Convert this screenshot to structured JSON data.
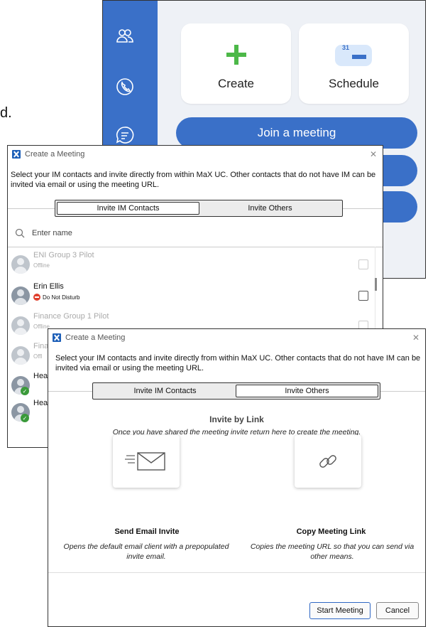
{
  "background_fragment": "d.",
  "app": {
    "rail_icons": [
      "contacts-icon",
      "phone-icon",
      "chat-icon"
    ],
    "tiles": [
      {
        "label": "Create",
        "icon": "plus-icon",
        "accent": "#4cb848"
      },
      {
        "label": "Schedule",
        "icon": "calendar-icon",
        "badge": "31"
      }
    ],
    "join_label": "Join a meeting",
    "rail_color": "#3a70c8"
  },
  "dialog1": {
    "title": "Create a Meeting",
    "description": "Select your IM contacts and invite directly from within MaX UC.  Other contacts that do not have IM can be invited via email or using the meeting URL.",
    "tabs": [
      "Invite IM Contacts",
      "Invite Others"
    ],
    "active_tab": "Invite IM Contacts",
    "search_placeholder": "Enter name",
    "contacts": [
      {
        "name": "ENI Group 3 Pilot",
        "status": "Offline",
        "dim": true
      },
      {
        "name": "Erin Ellis",
        "status": "Do Not Disturb",
        "dim": false
      },
      {
        "name": "Finance Group 1 Pilot",
        "status": "Offline",
        "dim": true
      },
      {
        "name": "Fina",
        "status": "Offl",
        "dim": true
      },
      {
        "name": "Hea",
        "status": "",
        "dim": false
      },
      {
        "name": "Hea",
        "status": "",
        "dim": false
      }
    ]
  },
  "dialog2": {
    "title": "Create a Meeting",
    "description": "Select your IM contacts and invite directly from within MaX UC.  Other contacts that do not have IM can be invited via email or using the meeting URL.",
    "tabs": [
      "Invite IM Contacts",
      "Invite Others"
    ],
    "active_tab": "Invite Others",
    "heading": "Invite by Link",
    "subheading": "Once you have shared the meeting invite return here to create the meeting.",
    "options": [
      {
        "label": "Send Email Invite",
        "icon": "envelope-icon",
        "desc": "Opens the default email client with a prepopulated invite email."
      },
      {
        "label": "Copy Meeting Link",
        "icon": "link-icon",
        "desc": "Copies the meeting URL so that you can send via other means."
      }
    ],
    "start_label": "Start Meeting",
    "cancel_label": "Cancel"
  }
}
